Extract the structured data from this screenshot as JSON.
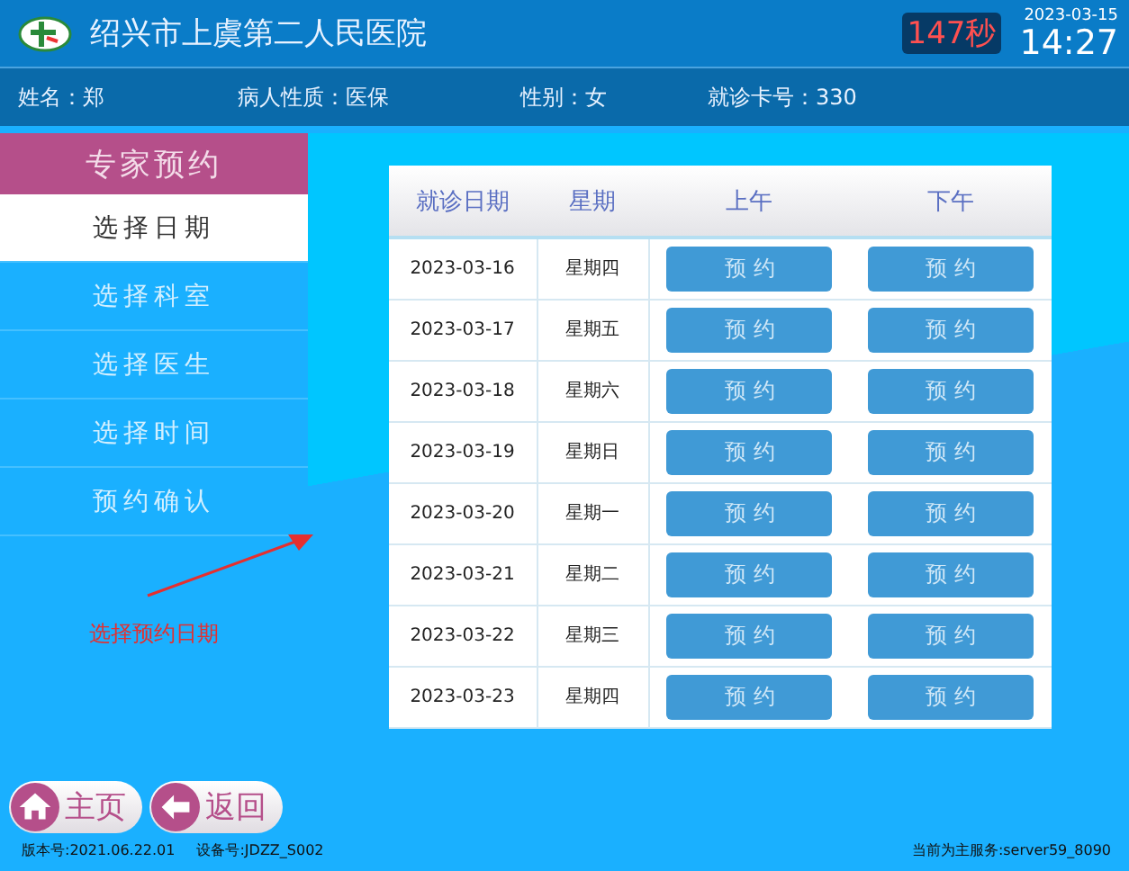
{
  "header": {
    "hospital": "绍兴市上虞第二人民医院",
    "countdown": "147秒",
    "date": "2023-03-15",
    "time": "14:27"
  },
  "patient": [
    {
      "text": "姓名：郑"
    },
    {
      "text": "病人性质：医保"
    },
    {
      "text": "性别：女"
    },
    {
      "text": "就诊卡号：330"
    }
  ],
  "sidebar": {
    "title": "专家预约",
    "items": [
      {
        "label": "选择日期",
        "selected": true
      },
      {
        "label": "选择科室",
        "selected": false
      },
      {
        "label": "选择医生",
        "selected": false
      },
      {
        "label": "选择时间",
        "selected": false
      },
      {
        "label": "预约确认",
        "selected": false
      }
    ],
    "hint": "选择预约日期"
  },
  "table": {
    "columns": [
      "就诊日期",
      "星期",
      "上午",
      "下午"
    ],
    "rows": [
      {
        "date": "2023-03-16",
        "weekday": "星期四",
        "am": "预 约",
        "pm": "预 约"
      },
      {
        "date": "2023-03-17",
        "weekday": "星期五",
        "am": "预 约",
        "pm": "预 约"
      },
      {
        "date": "2023-03-18",
        "weekday": "星期六",
        "am": "预 约",
        "pm": "预 约"
      },
      {
        "date": "2023-03-19",
        "weekday": "星期日",
        "am": "预 约",
        "pm": "预 约"
      },
      {
        "date": "2023-03-20",
        "weekday": "星期一",
        "am": "预 约",
        "pm": "预 约"
      },
      {
        "date": "2023-03-21",
        "weekday": "星期二",
        "am": "预 约",
        "pm": "预 约"
      },
      {
        "date": "2023-03-22",
        "weekday": "星期三",
        "am": "预 约",
        "pm": "预 约"
      },
      {
        "date": "2023-03-23",
        "weekday": "星期四",
        "am": "预 约",
        "pm": "预 约"
      }
    ]
  },
  "nav_buttons": [
    {
      "kind": "home",
      "label": "主页"
    },
    {
      "kind": "back",
      "label": "返回"
    }
  ],
  "footer": {
    "version": "版本号:2021.06.22.01",
    "device": "设备号:JDZZ_S002",
    "server": "当前为主服务:server59_8090"
  }
}
